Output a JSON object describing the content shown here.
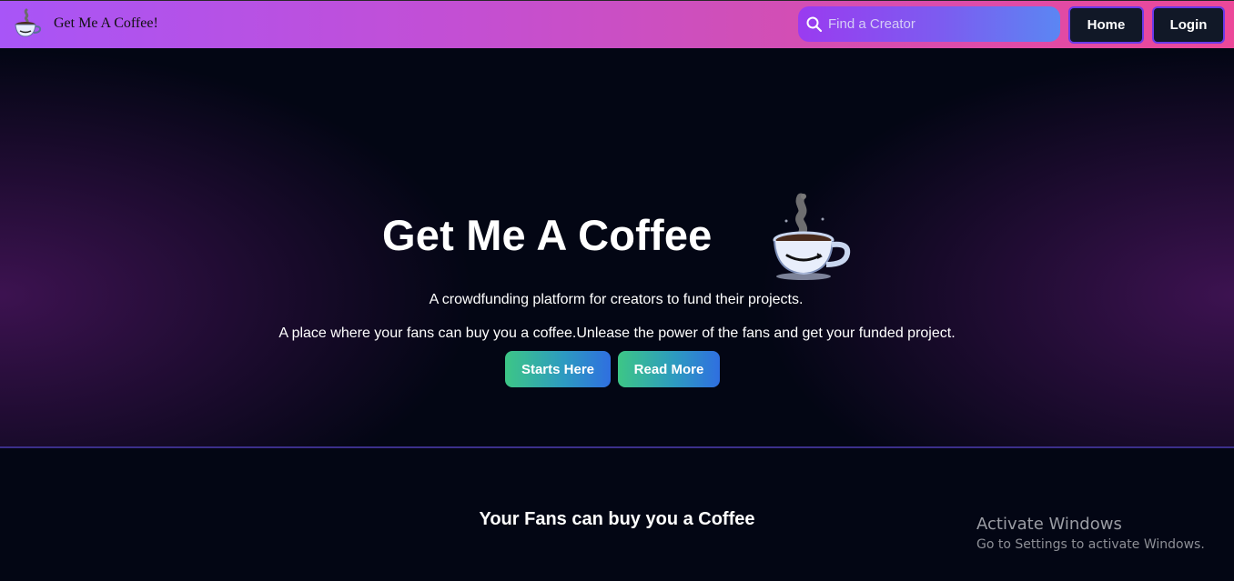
{
  "navbar": {
    "brand": {
      "text": "Get Me A Coffee!",
      "logo_icon": "coffee-cup-icon"
    },
    "search": {
      "placeholder": "Find a Creator",
      "value": "",
      "icon": "search-icon"
    },
    "home_label": "Home",
    "login_label": "Login"
  },
  "hero": {
    "title": "Get Me A Coffee",
    "cup_icon": "coffee-cup-icon",
    "line1": "A crowdfunding platform for creators to fund their projects.",
    "line2": "A place where your fans can buy you a coffee.Unlease the power of the fans and get your funded project.",
    "start_label": "Starts Here",
    "read_label": "Read More"
  },
  "section": {
    "title": "Your Fans can buy you a Coffee"
  },
  "watermark": {
    "title": "Activate Windows",
    "subtitle": "Go to Settings to activate Windows."
  },
  "colors": {
    "page_bg": "#030614",
    "navbar_gradient_start": "#a855f7",
    "navbar_gradient_end": "#ec4899",
    "button_gradient_start": "#3dc686",
    "button_gradient_end": "#2f6fe0",
    "nav_button_bg": "#111827",
    "divider": "#3b2f8a"
  }
}
